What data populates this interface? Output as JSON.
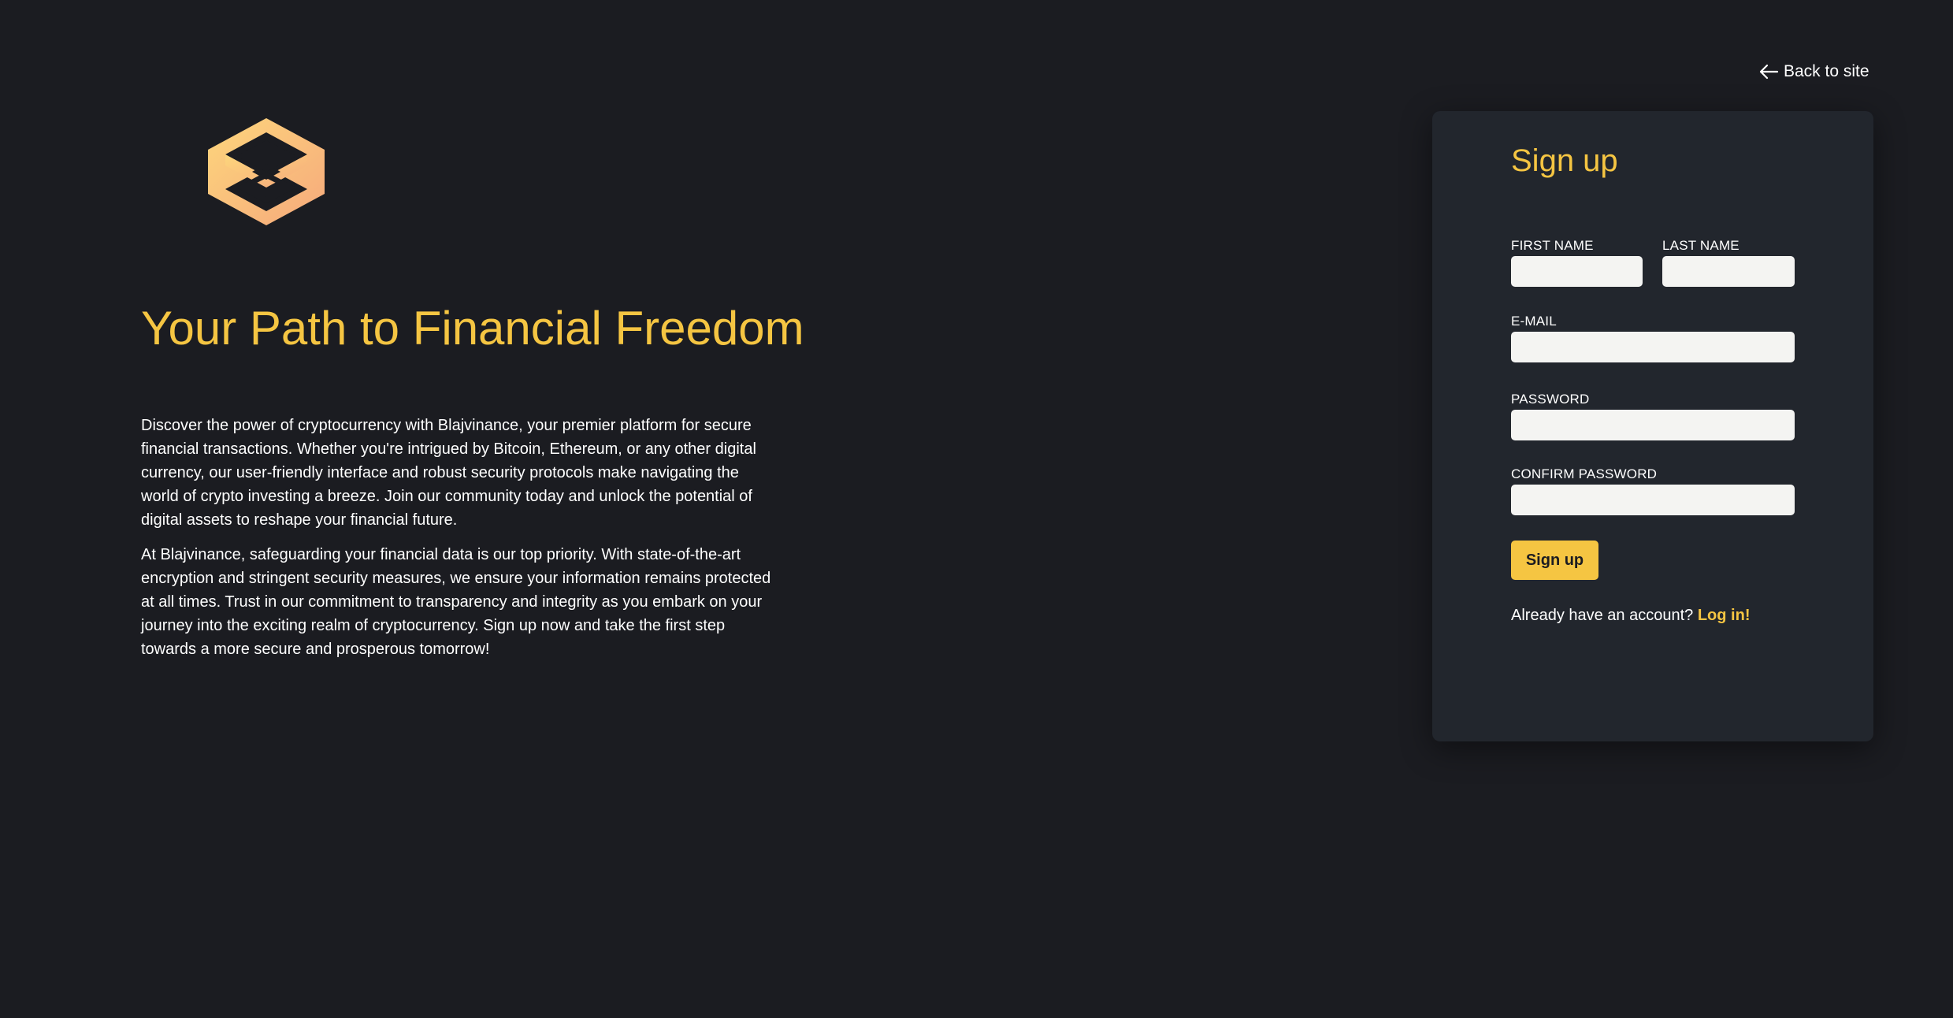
{
  "colors": {
    "background": "#1b1c21",
    "card": "#22262d",
    "accent": "#f5c542",
    "logo_light": "#fcd27a",
    "logo_dark": "#f5a878",
    "input_bg": "#f4f4f2"
  },
  "hero": {
    "logo_icon": "hexagon-logo-icon",
    "title": "Your Path to Financial Freedom",
    "paragraphs": [
      "Discover the power of cryptocurrency with Blajvinance, your premier platform for secure financial transactions. Whether you're intrigued by Bitcoin, Ethereum, or any other digital currency, our user-friendly interface and robust security protocols make navigating the world of crypto investing a breeze. Join our community today and unlock the potential of digital assets to reshape your financial future.",
      "At Blajvinance, safeguarding your financial data is our top priority. With state-of-the-art encryption and stringent security measures, we ensure your information remains protected at all times. Trust in our commitment to transparency and integrity as you embark on your journey into the exciting realm of cryptocurrency. Sign up now and take the first step towards a more secure and prosperous tomorrow!"
    ]
  },
  "nav": {
    "back_icon": "arrow-left-icon",
    "back_label": "Back to site"
  },
  "signup": {
    "title": "Sign up",
    "fields": {
      "first_name": {
        "label": "FIRST NAME",
        "value": ""
      },
      "last_name": {
        "label": "LAST NAME",
        "value": ""
      },
      "email": {
        "label": "E-MAIL",
        "value": ""
      },
      "password": {
        "label": "PASSWORD",
        "value": ""
      },
      "confirm_password": {
        "label": "CONFIRM PASSWORD",
        "value": ""
      }
    },
    "submit_label": "Sign up",
    "login_prompt": "Already have an account?",
    "login_link": "Log in!"
  }
}
